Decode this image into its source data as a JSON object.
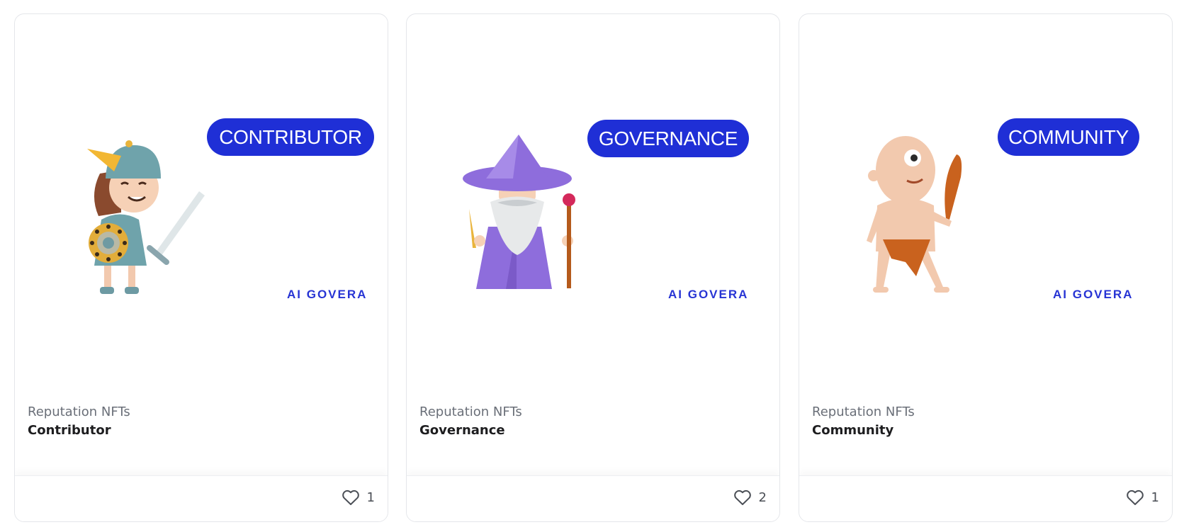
{
  "cards": [
    {
      "badge": "CONTRIBUTOR",
      "brand": "AI GOVERA",
      "collection": "Reputation NFTs",
      "title": "Contributor",
      "likes": "1",
      "character_icon": "valkyrie-warrior",
      "like_icon": "heart-icon"
    },
    {
      "badge": "GOVERNANCE",
      "brand": "AI GOVERA",
      "collection": "Reputation NFTs",
      "title": "Governance",
      "likes": "2",
      "character_icon": "wizard",
      "like_icon": "heart-icon"
    },
    {
      "badge": "COMMUNITY",
      "brand": "AI GOVERA",
      "collection": "Reputation NFTs",
      "title": "Community",
      "likes": "1",
      "character_icon": "cyclops-caveman",
      "like_icon": "heart-icon"
    }
  ],
  "colors": {
    "badge": "#1f2fd6",
    "brand": "#2734d4",
    "subtitle": "#6a6f78",
    "title": "#1d1d1f"
  }
}
